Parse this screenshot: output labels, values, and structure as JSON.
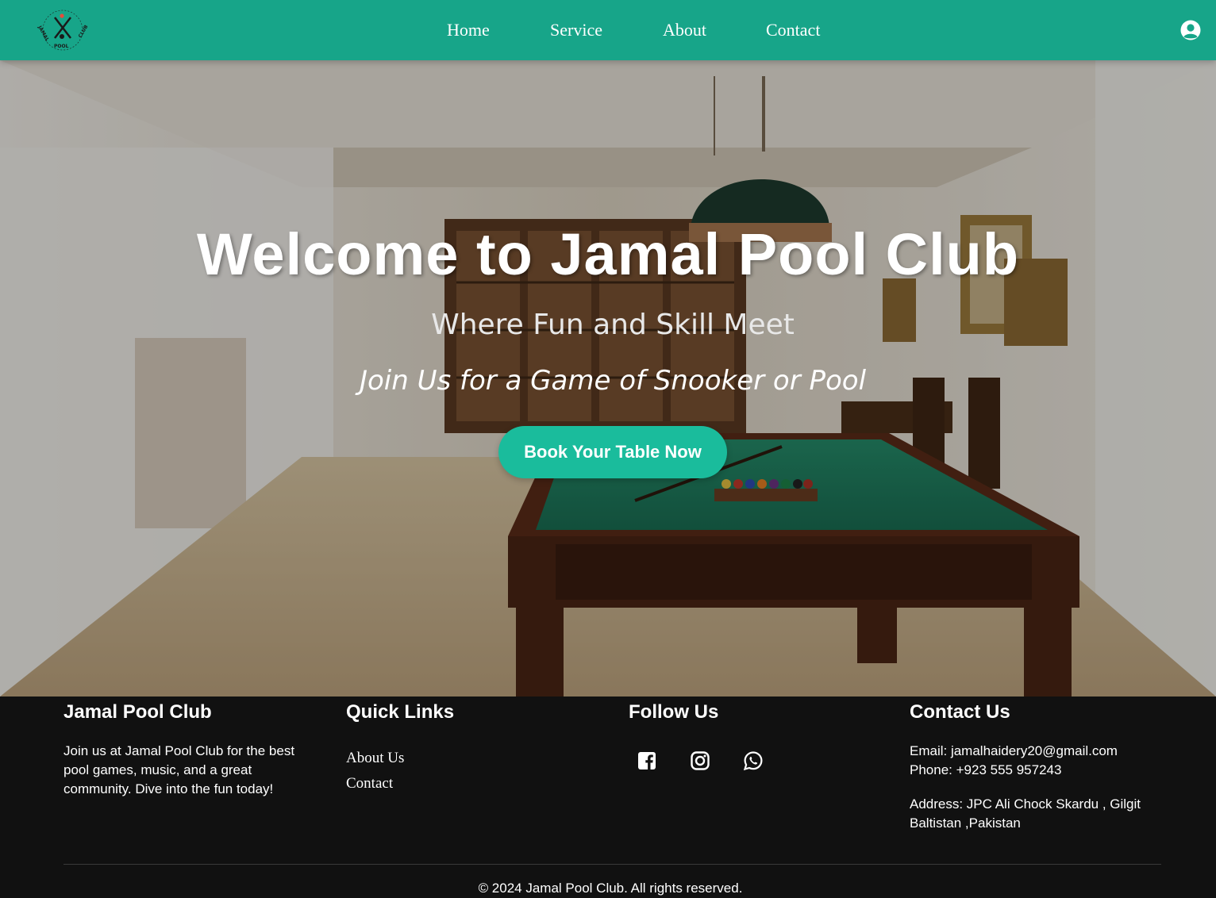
{
  "nav": {
    "logo_text": "THE JAMAL POOL CLUB",
    "links": [
      "Home",
      "Service",
      "About",
      "Contact"
    ],
    "user_icon": "user-circle-icon"
  },
  "hero": {
    "title": "Welcome to Jamal Pool Club",
    "subtitle": "Where Fun and Skill Meet",
    "tagline": "Join Us for a Game of Snooker or Pool",
    "button_label": "Book Your Table Now"
  },
  "footer": {
    "about": {
      "heading": "Jamal Pool Club",
      "text": "Join us at Jamal Pool Club for the best pool games, music, and a great community. Dive into the fun today!"
    },
    "quick_links": {
      "heading": "Quick Links",
      "links": [
        "About Us",
        "Contact"
      ]
    },
    "follow": {
      "heading": "Follow Us",
      "icons": [
        "facebook-icon",
        "instagram-icon",
        "whatsapp-icon"
      ]
    },
    "contact": {
      "heading": "Contact Us",
      "email": "Email: jamalhaidery20@gmail.com",
      "phone": "Phone: +923 555 957243",
      "address": "Address: JPC Ali Chock Skardu , Gilgit Baltistan ,Pakistan"
    },
    "copyright": "© 2024 Jamal Pool Club. All rights reserved."
  },
  "colors": {
    "navbar": "#17a589",
    "button": "#1abc9c",
    "footer": "#111111",
    "table_felt": "#1b6e55"
  }
}
